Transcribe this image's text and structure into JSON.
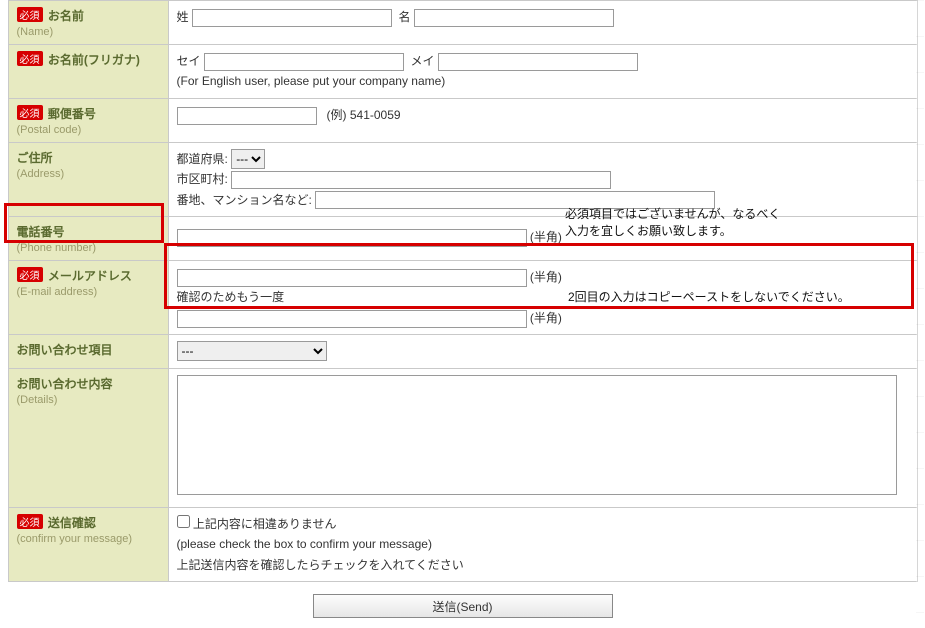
{
  "required_badge": "必須",
  "rows": {
    "name": {
      "jp": "お名前",
      "en": "(Name)",
      "sei": "姓",
      "mei": "名"
    },
    "kana": {
      "jp": "お名前(フリガナ)",
      "sei": "セイ",
      "mei": "メイ",
      "note": "(For English user, please put your company name)"
    },
    "postal": {
      "jp": "郵便番号",
      "en": "(Postal code)",
      "ex_label": "(例)",
      "ex_value": "541-0059"
    },
    "address": {
      "jp": "ご住所",
      "en": "(Address)",
      "pref_label": "都道府県:",
      "pref_value": "---",
      "city_label": "市区町村:",
      "street_label": "番地、マンション名など:"
    },
    "phone": {
      "jp": "電話番号",
      "en": "(Phone number)",
      "han": "(半角)"
    },
    "email": {
      "jp": "メールアドレス",
      "en": "(E-mail address)",
      "han": "(半角)",
      "again": "確認のためもう一度"
    },
    "subject": {
      "jp": "お問い合わせ項目",
      "value": "---"
    },
    "details": {
      "jp": "お問い合わせ内容",
      "en": "(Details)"
    },
    "confirm": {
      "jp": "送信確認",
      "en": "(confirm your message)",
      "check_label": "上記内容に相違ありません",
      "note1": "(please check the box to confirm your message)",
      "note2": "上記送信内容を確認したらチェックを入れてください"
    }
  },
  "callouts": {
    "phone_note_l1": "必須項目ではございませんが、なるべく",
    "phone_note_l2": "入力を宜しくお願い致します。",
    "email_note": "2回目の入力はコピーペーストをしないでください。"
  },
  "submit_label": "送信(Send)"
}
